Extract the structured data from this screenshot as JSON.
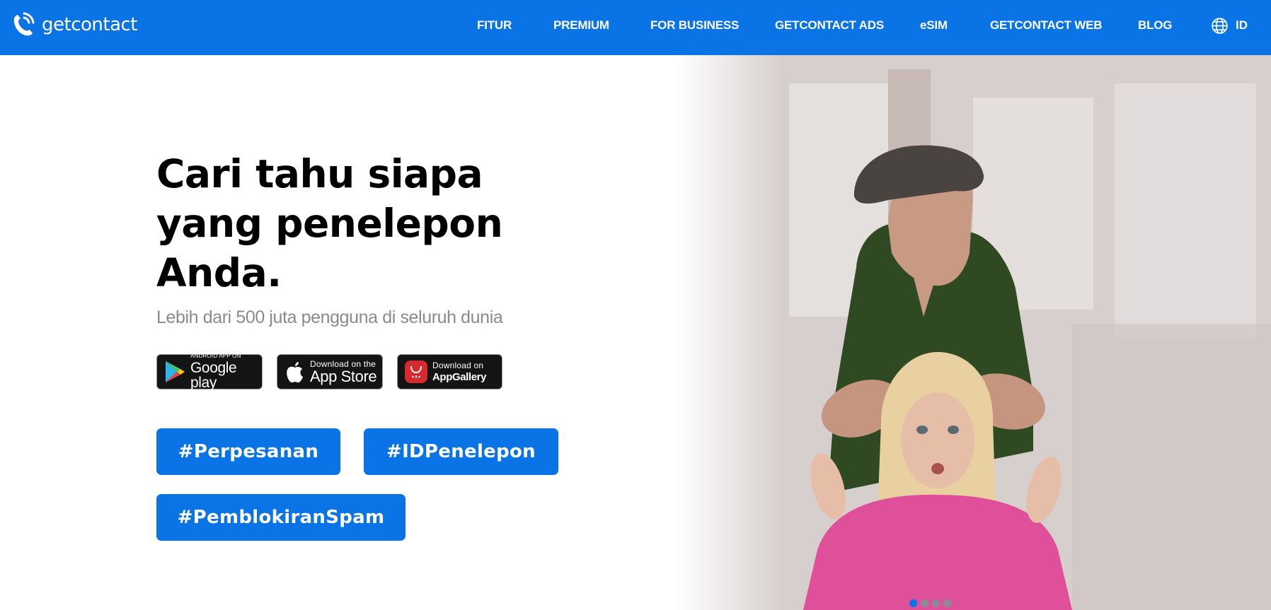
{
  "brand": {
    "name": "getcontact",
    "color": "#0a74e6"
  },
  "nav": {
    "items": [
      {
        "label": "FITUR"
      },
      {
        "label": "PREMIUM"
      },
      {
        "label": "FOR BUSINESS"
      },
      {
        "label": "GETCONTACT ADS"
      },
      {
        "label": "eSIM"
      },
      {
        "label": "GETCONTACT WEB"
      },
      {
        "label": "BLOG"
      }
    ],
    "language": "ID"
  },
  "hero": {
    "headline_lines": [
      "Cari tahu siapa",
      "yang penelepon",
      "Anda."
    ],
    "subtitle": "Lebih dari 500 juta pengguna di seluruh dunia"
  },
  "stores": {
    "google": {
      "small": "ANDROID APP ON",
      "big": "Google play",
      "icon": "google-play-icon"
    },
    "apple": {
      "small": "Download on the",
      "big": "App Store",
      "icon": "apple-icon"
    },
    "huawei": {
      "small": "Download on",
      "big": "AppGallery",
      "icon": "huawei-appgallery-icon"
    }
  },
  "tags": [
    "#Perpesanan",
    "#IDPenelepon",
    "#PemblokiranSpam"
  ],
  "carousel": {
    "slides": 4,
    "active": 1
  }
}
